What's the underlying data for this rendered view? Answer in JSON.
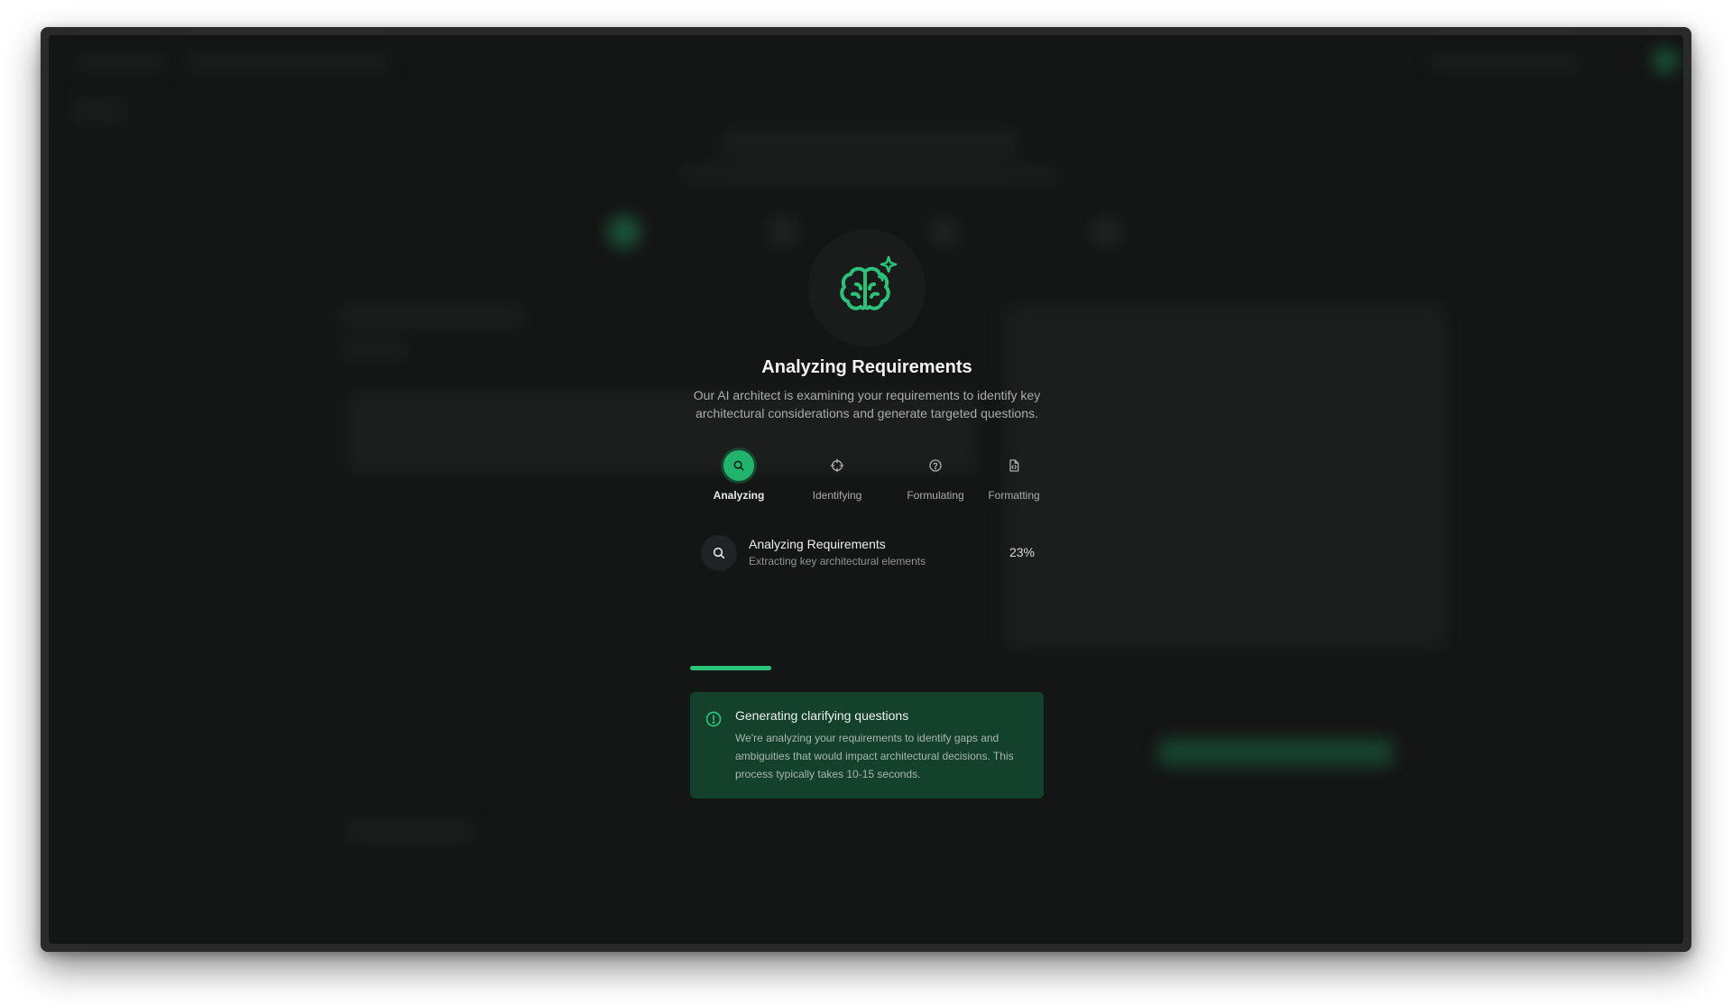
{
  "modal": {
    "title": "Analyzing Requirements",
    "description": "Our AI architect is examining your requirements to identify key architectural considerations and generate targeted questions.",
    "header_icon": "brain-sparkle-icon",
    "steps": [
      {
        "label": "Analyzing",
        "icon": "search-icon",
        "active": true
      },
      {
        "label": "Identifying",
        "icon": "crosshair-icon",
        "active": false
      },
      {
        "label": "Formulating",
        "icon": "question-circle-icon",
        "active": false
      },
      {
        "label": "Formatting",
        "icon": "file-code-icon",
        "active": false
      }
    ],
    "current_task": {
      "title": "Analyzing Requirements",
      "subtitle": "Extracting key architectural elements",
      "percent_label": "23%",
      "progress": 0.23,
      "icon": "search-icon"
    },
    "info": {
      "title": "Generating clarifying questions",
      "body": "We're analyzing your requirements to identify gaps and ambiguities that would impact architectural decisions. This process typically takes 10-15 seconds.",
      "icon": "alert-circle-icon"
    }
  },
  "colors": {
    "accent": "#22b36c",
    "background": "#141515",
    "info_background": "#14412b"
  }
}
